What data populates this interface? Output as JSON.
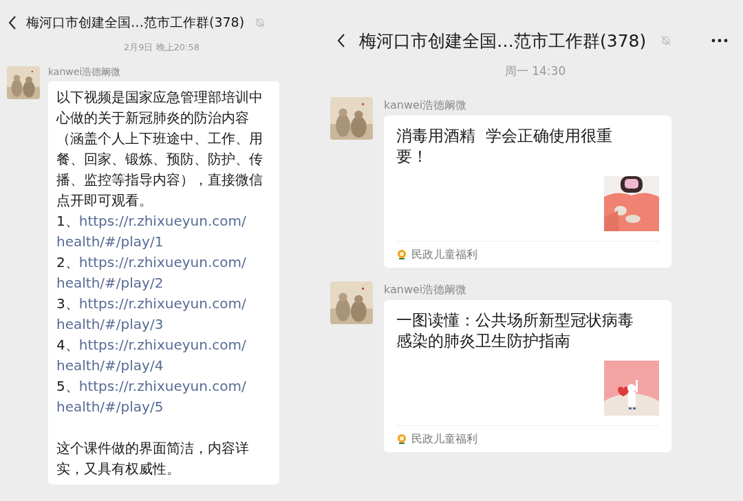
{
  "left_screen": {
    "header": {
      "title": "梅河口市创建全国…范市工作群(378)",
      "muted": true
    },
    "messages": [
      {
        "timestamp": "2月9日 晚上20:58",
        "sender": "kanwei浩德阚微",
        "intro": "以下视频是国家应急管理部培训中心做的关于新冠肺炎的防治内容（涵盖个人上下班途中、工作、用餐、回家、锻炼、预防、防护、传播、监控等指导内容），直接微信点开即可观看。",
        "links": [
          {
            "number": "1、",
            "url": "https://r.zhixueyun.com/health/#/play/1"
          },
          {
            "number": "2、",
            "url": "https://r.zhixueyun.com/health/#/play/2"
          },
          {
            "number": "3、",
            "url": "https://r.zhixueyun.com/health/#/play/3"
          },
          {
            "number": "4、",
            "url": "https://r.zhixueyun.com/health/#/play/4"
          },
          {
            "number": "5、",
            "url": "https://r.zhixueyun.com/health/#/play/5"
          }
        ],
        "closing": "这个课件做的界面简洁，内容详实，又具有权威性。"
      }
    ]
  },
  "right_screen": {
    "header": {
      "title": "梅河口市创建全国…范市工作群(378)",
      "muted": true
    },
    "timestamp": "周一 14:30",
    "messages": [
      {
        "sender": "kanwei浩德阚微",
        "card_title": "消毒用酒精  学会正确使用很重要！",
        "source": "民政儿童福利"
      },
      {
        "sender": "kanwei浩德阚微",
        "card_title": "一图读懂：公共场所新型冠状病毒感染的肺炎卫生防护指南",
        "source": "民政儿童福利"
      }
    ]
  }
}
